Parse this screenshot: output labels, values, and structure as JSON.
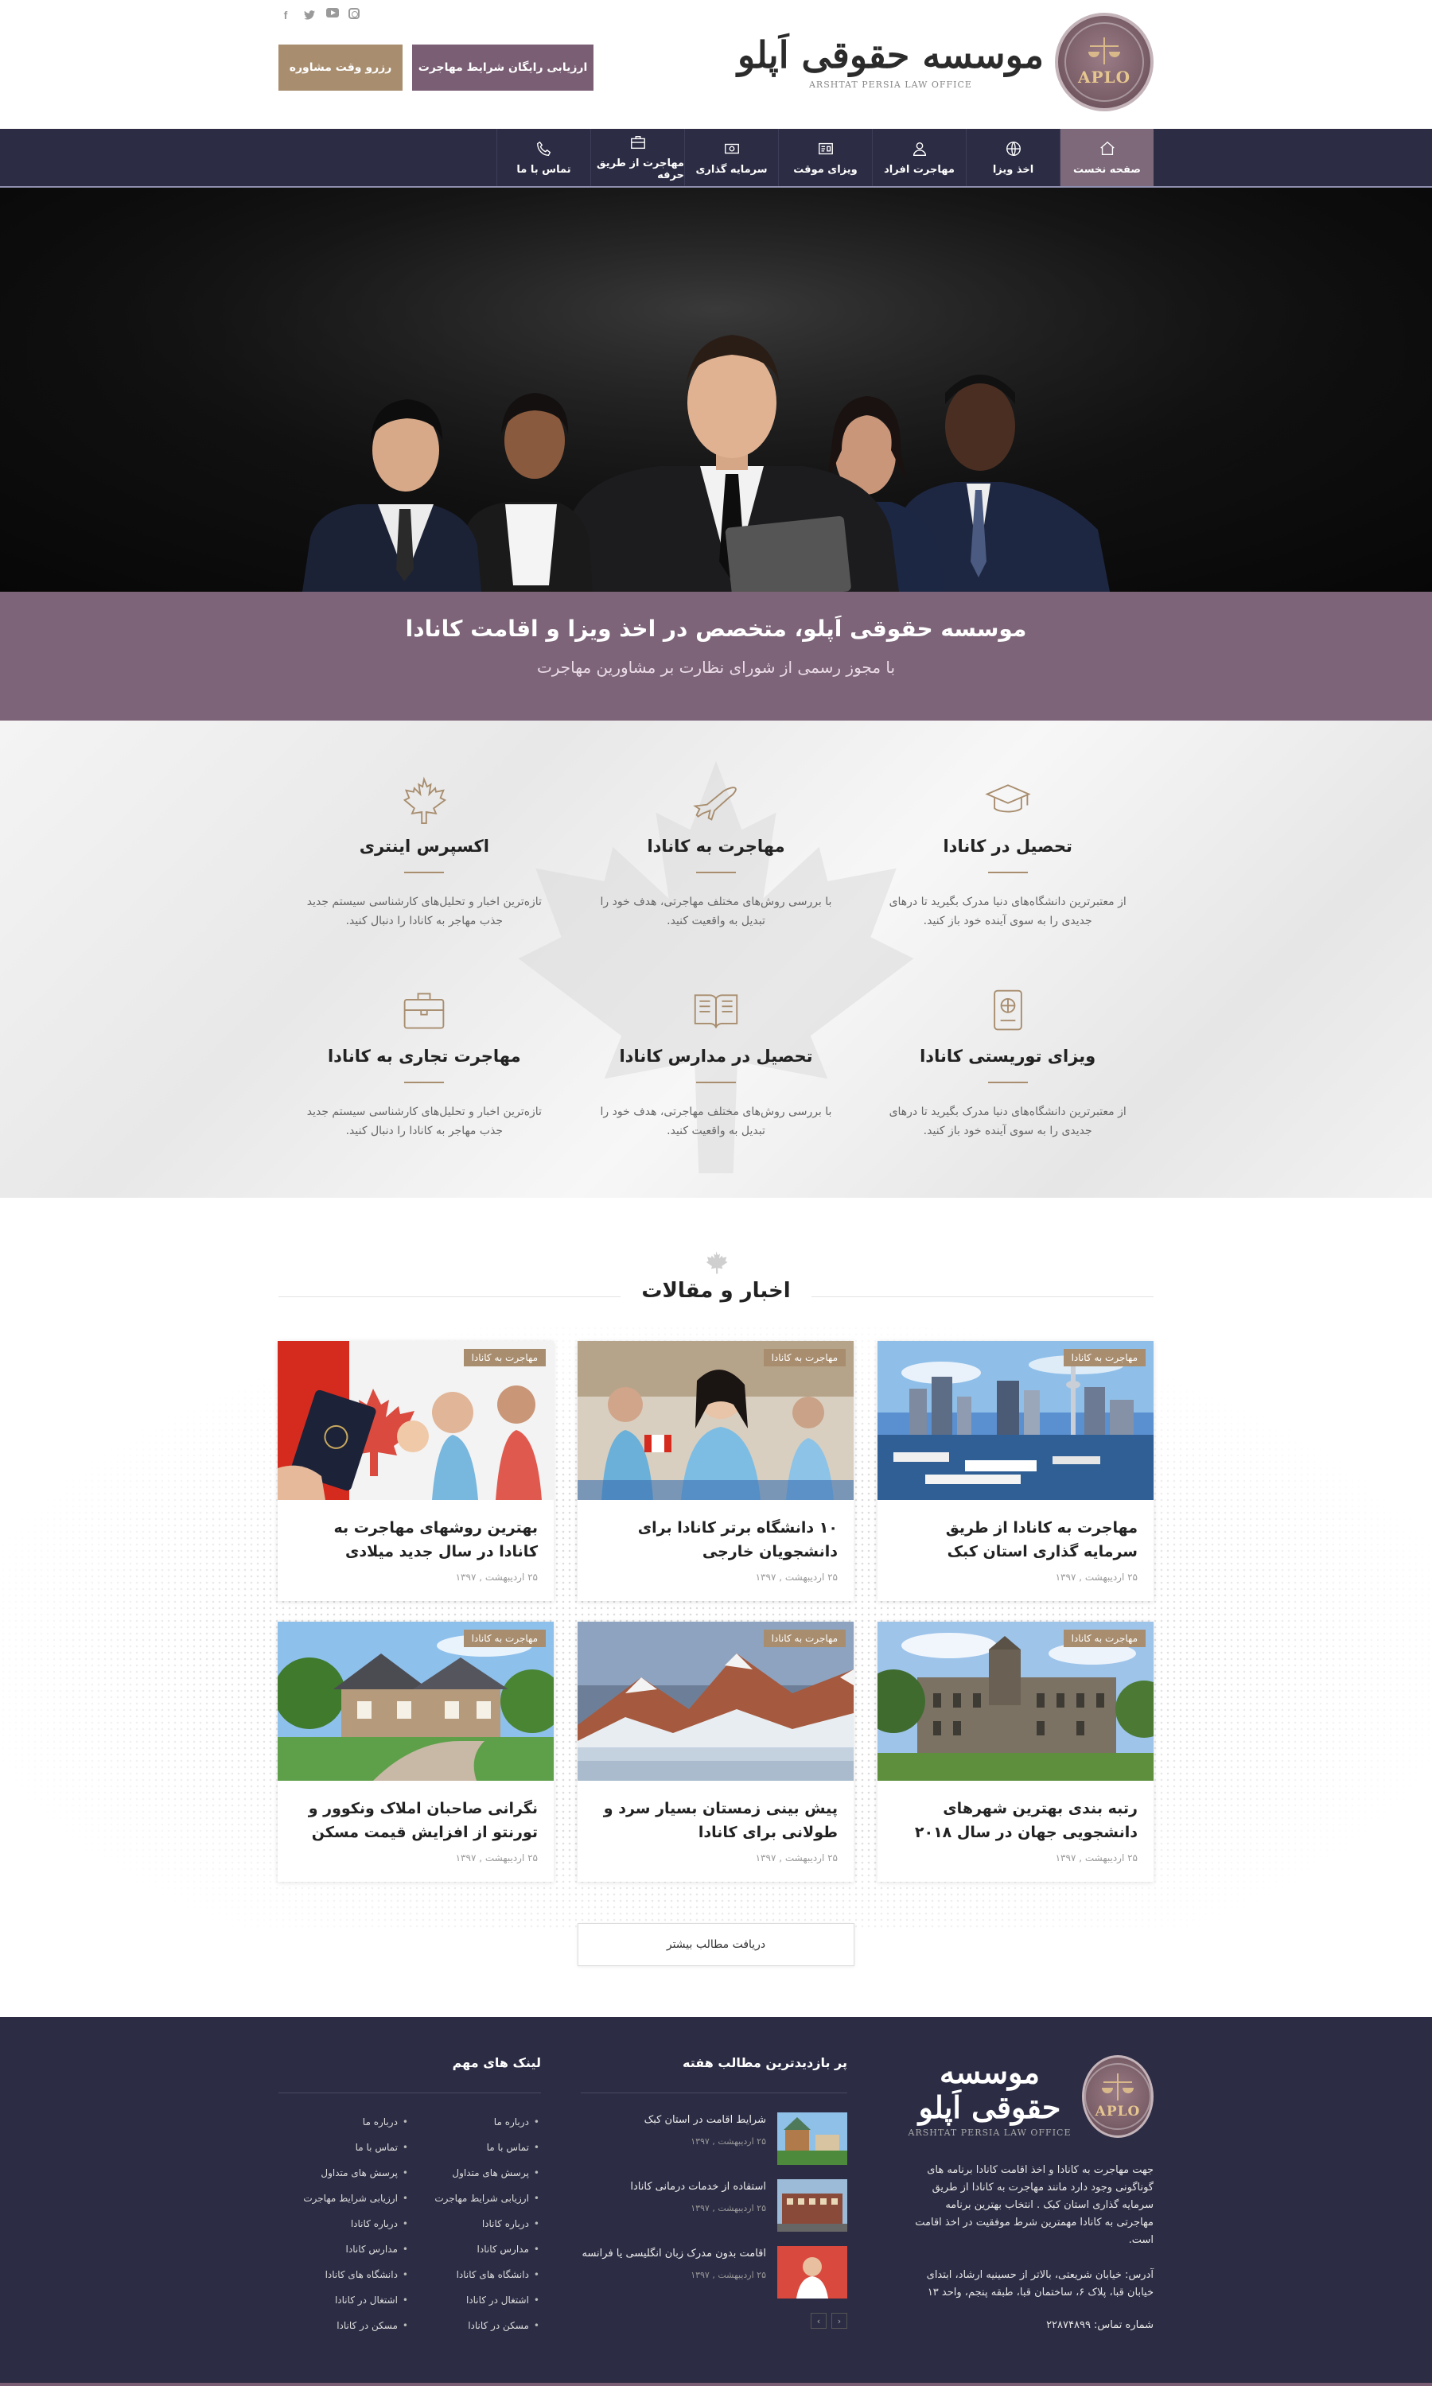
{
  "header": {
    "logo_fa": "موسسه حقوقی اَپلو",
    "logo_en": "ARSHTAT PERSIA LAW OFFICE",
    "seal_text": "APLO",
    "btn_reserve": "رزرو وقت مشاوره",
    "btn_evaluate": "ارزیابی رایگان شرایط مهاجرت",
    "socials": [
      "facebook-icon",
      "twitter-icon",
      "youtube-icon",
      "instagram-icon"
    ]
  },
  "nav": {
    "items": [
      {
        "label": "صفحه نخست",
        "icon": "home-icon",
        "active": true
      },
      {
        "label": "اخذ ویزا",
        "icon": "globe-icon"
      },
      {
        "label": "مهاجرت افراد",
        "icon": "person-icon"
      },
      {
        "label": "ویزای موقت",
        "icon": "id-card-icon"
      },
      {
        "label": "سرمایه گذاری",
        "icon": "money-icon"
      },
      {
        "label": "مهاجرت از طریق حرفه",
        "icon": "briefcase-icon"
      },
      {
        "label": "تماس با ما",
        "icon": "phone-icon"
      }
    ]
  },
  "banner": {
    "title": "موسسه حقوقی اَپلو، متخصص در اخذ ویزا و اقامت کانادا",
    "subtitle": "با مجوز رسمی از شورای نظارت بر مشاورین مهاجرت"
  },
  "services": [
    {
      "title": "تحصیل در کانادا",
      "icon": "graduation-cap-icon",
      "text": "از معتبرترین دانشگاه‌های دنیا مدرک بگیرید تا درهای جدیدی را به سوی آینده خود باز کنید."
    },
    {
      "title": "مهاجرت به کانادا",
      "icon": "airplane-icon",
      "text": "با بررسی روش‌های مختلف مهاجرتی، هدف خود را تبدیل به واقعیت کنید."
    },
    {
      "title": "اکسپرس اینتری",
      "icon": "maple-leaf-icon",
      "text": "تازه‌ترین اخبار و تحلیل‌های کارشناسی سیستم جدید جذب مهاجر به کانادا را دنبال کنید."
    },
    {
      "title": "ویزای توریستی کانادا",
      "icon": "passport-icon",
      "text": "از معتبرترین دانشگاه‌های دنیا مدرک بگیرید تا درهای جدیدی را به سوی آینده خود باز کنید."
    },
    {
      "title": "تحصیل در مدارس کانادا",
      "icon": "book-icon",
      "text": "با بررسی روش‌های مختلف مهاجرتی، هدف خود را تبدیل به واقعیت کنید."
    },
    {
      "title": "مهاجرت تجاری به کانادا",
      "icon": "briefcase-icon",
      "text": "تازه‌ترین اخبار و تحلیل‌های کارشناسی سیستم جدید جذب مهاجر به کانادا را دنبال کنید."
    }
  ],
  "news": {
    "title": "اخبار و مقالات",
    "badge": "مهاجرت به کانادا",
    "date": "۲۵ اردیبهشت , ۱۳۹۷",
    "more": "دریافت مطالب بیشتر",
    "cards": [
      {
        "title": "مهاجرت به کانادا از طریق سرمایه گذاری استان کبک",
        "image": "city-harbor"
      },
      {
        "title": "۱۰ دانشگاه برتر کانادا برای دانشجویان خارجی",
        "image": "students"
      },
      {
        "title": "بهترین روشهای مهاجرت به کانادا در سال جدید میلادی",
        "image": "passport-flag"
      },
      {
        "title": "رتبه بندی بهترین شهرهای دانشجویی جهان در سال ۲۰۱۸",
        "image": "university"
      },
      {
        "title": "پیش بینی زمستان بسیار سرد و طولانی برای کانادا",
        "image": "mountains"
      },
      {
        "title": "نگرانی صاحبان املاک ونکوور و تورنتو از افزایش قیمت مسکن",
        "image": "house"
      }
    ]
  },
  "footer": {
    "about": "جهت مهاجرت به کانادا و اخذ اقامت کانادا برنامه های گوناگونی وجود دارد مانند مهاجرت به کانادا از طریق سرمایه گذاری استان کبک . انتخاب بهترین برنامه مهاجرتی به کانادا مهمترین شرط موفقیت در اخذ اقامت است.",
    "address": "آدرس: خیابان شریعتی، بالاتر از حسینیه ارشاد، ابتدای خیابان قبا، پلاک ۶، ساختمان قبا، طبقه پنجم، واحد ۱۳",
    "phone": "شماره تماس: ۲۲۸۷۴۸۹۹",
    "popular_title": "پر بازدیدترین مطالب هفته",
    "popular": [
      {
        "title": "شرایط اقامت در استان کبک",
        "date": "۲۵ اردیبهشت , ۱۳۹۷"
      },
      {
        "title": "استفاده از خدمات درمانی کانادا",
        "date": "۲۵ اردیبهشت , ۱۳۹۷"
      },
      {
        "title": "اقامت بدون مدرک زبان انگلیسی یا فرانسه",
        "date": "۲۵ اردیبهشت , ۱۳۹۷"
      }
    ],
    "links_title": "لینک های مهم",
    "links_right": [
      "درباره ما",
      "تماس با ما",
      "پرسش های متداول",
      "ارزیابی شرایط مهاجرت",
      "درباره کانادا",
      "مدارس کانادا",
      "دانشگاه های کانادا",
      "اشتغال در کانادا",
      "مسکن در کانادا"
    ],
    "links_left": [
      "درباره ما",
      "تماس با ما",
      "پرسش های متداول",
      "ارزیابی شرایط مهاجرت",
      "درباره کانادا",
      "مدارس کانادا",
      "دانشگاه های کانادا",
      "اشتغال در کانادا",
      "مسکن در کانادا"
    ]
  },
  "colors": {
    "navy": "#2c2c44",
    "gold": "#a88d6e",
    "purple": "#7a5e74",
    "banner": "#7d6479"
  }
}
